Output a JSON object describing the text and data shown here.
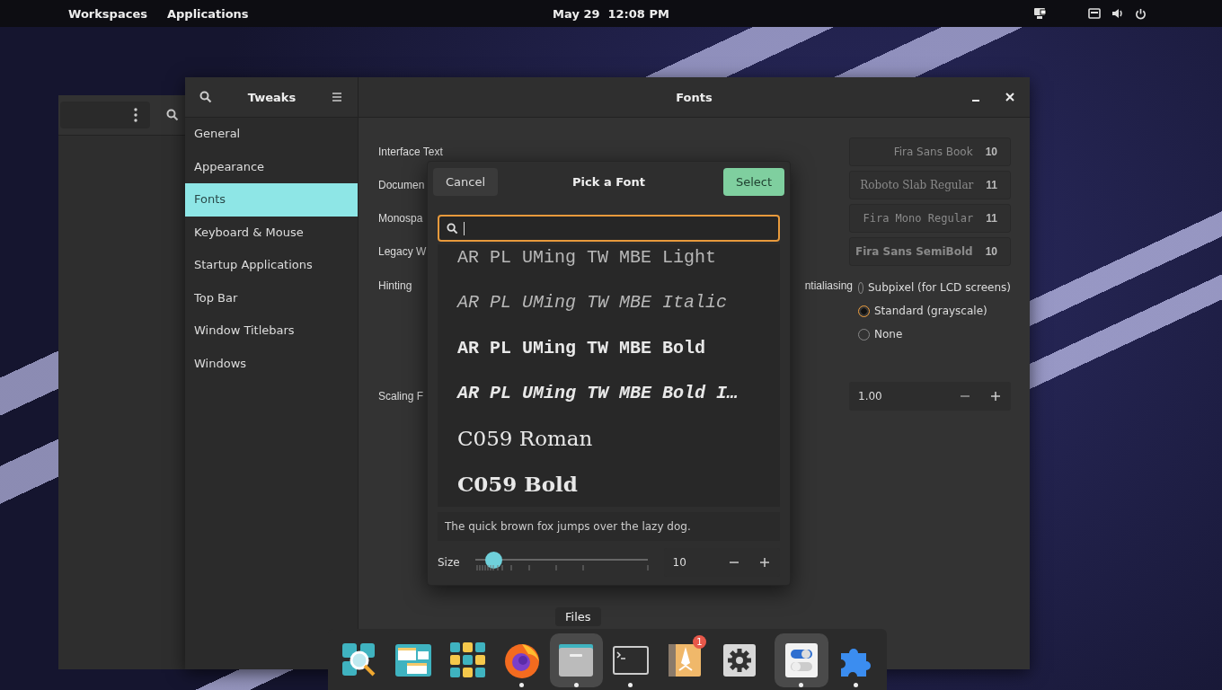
{
  "top_bar": {
    "left": [
      "Workspaces",
      "Applications"
    ],
    "clock": "May 29  12:08 PM"
  },
  "tweaks": {
    "title": "Tweaks",
    "page_title": "Fonts",
    "sidebar": [
      {
        "label": "General",
        "selected": false
      },
      {
        "label": "Appearance",
        "selected": false
      },
      {
        "label": "Fonts",
        "selected": true
      },
      {
        "label": "Keyboard & Mouse",
        "selected": false
      },
      {
        "label": "Startup Applications",
        "selected": false
      },
      {
        "label": "Top Bar",
        "selected": false
      },
      {
        "label": "Window Titlebars",
        "selected": false
      },
      {
        "label": "Windows",
        "selected": false
      }
    ],
    "font_rows": [
      {
        "label": "Interface Text",
        "font": "Fira Sans Book",
        "size": "10",
        "kind": "sans"
      },
      {
        "label": "Documen",
        "font": "Roboto Slab Regular",
        "size": "11",
        "kind": "serif"
      },
      {
        "label": "Monospa",
        "font": "Fira Mono Regular",
        "size": "11",
        "kind": "mono"
      },
      {
        "label": "Legacy W",
        "font": "Fira Sans SemiBold",
        "size": "10",
        "kind": "semibold"
      }
    ],
    "hinting_label": "Hinting",
    "antialiasing": {
      "label": "ntialiasing",
      "options": [
        {
          "label": "Subpixel (for LCD screens)",
          "selected": false
        },
        {
          "label": "Standard (grayscale)",
          "selected": true
        },
        {
          "label": "None",
          "selected": false
        }
      ]
    },
    "scaling": {
      "label": "Scaling F",
      "value": "1.00"
    }
  },
  "dialog": {
    "cancel": "Cancel",
    "title": "Pick a Font",
    "select": "Select",
    "fonts": [
      {
        "name": "AR PL UMing TW MBE Light",
        "kind": "light"
      },
      {
        "name": "AR PL UMing TW MBE Italic",
        "kind": "italic"
      },
      {
        "name": "AR PL UMing TW MBE Bold",
        "kind": "bold"
      },
      {
        "name": "AR PL UMing TW MBE Bold I…",
        "kind": "bolditalic"
      },
      {
        "name": "C059 Roman",
        "kind": "roman"
      },
      {
        "name": "C059 Bold",
        "kind": "romanbold"
      }
    ],
    "preview": "The quick brown fox jumps over the lazy dog.",
    "size_label": "Size",
    "size_slider": {
      "level": 0.06
    },
    "size_value": "10"
  },
  "dock": {
    "tooltip": "Files",
    "items": [
      {
        "kind": "search-tool",
        "selected": false,
        "running": false
      },
      {
        "kind": "windows",
        "selected": false,
        "running": false
      },
      {
        "kind": "app-grid",
        "selected": false,
        "running": false
      },
      {
        "kind": "browser",
        "selected": false,
        "running": true
      },
      {
        "kind": "folder",
        "selected": true,
        "running": true
      },
      {
        "kind": "terminal",
        "selected": false,
        "running": true
      },
      {
        "kind": "launcher",
        "selected": false,
        "running": false,
        "badge": "1"
      },
      {
        "kind": "gear",
        "selected": false,
        "running": false
      },
      {
        "kind": "toggles",
        "selected": true,
        "running": true
      },
      {
        "kind": "puzzle",
        "selected": false,
        "running": true
      }
    ]
  }
}
